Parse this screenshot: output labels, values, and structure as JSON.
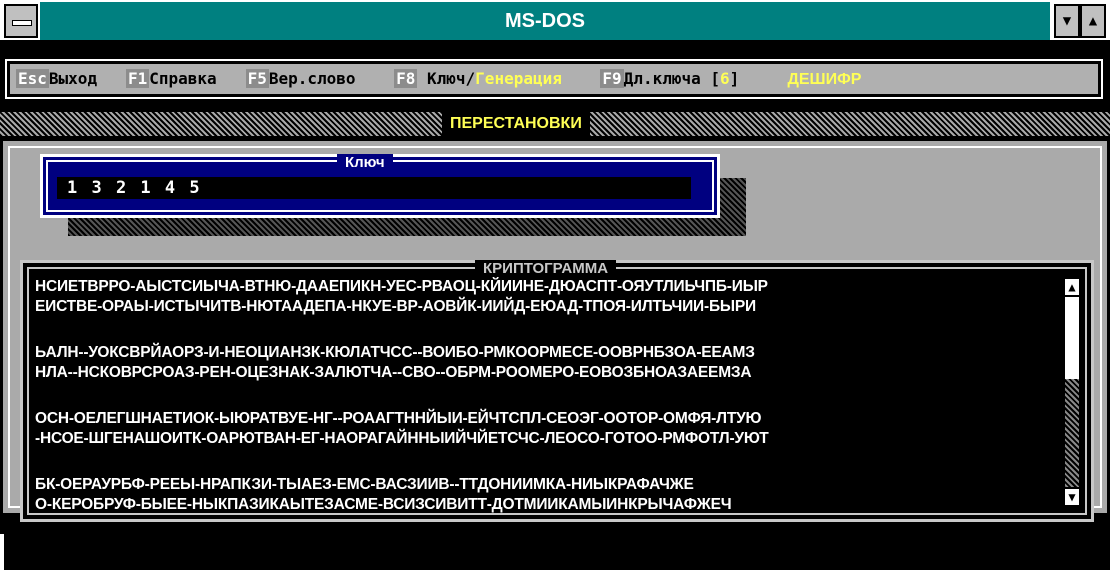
{
  "window": {
    "title": "MS-DOS",
    "min_button": "▼",
    "max_button": "▲"
  },
  "menu": {
    "esc_key": "Esc",
    "esc_label": "Выход",
    "f1_key": "F1",
    "f1_label": "Справка",
    "f5_key": "F5",
    "f5_label": "Вер.слово",
    "f8_key": "F8",
    "f8_label": "Ключ/",
    "f8_label_active": "Генерация",
    "f9_key": "F9",
    "f9_label": "Дл.ключа",
    "key_length_open": "[",
    "key_length_value": "6",
    "key_length_close": "]",
    "mode": "ДЕШИФР"
  },
  "banner": {
    "title": "ПЕРЕСТАНОВКИ"
  },
  "key_dialog": {
    "label": "Ключ",
    "value": "1 3 2 1 4 5"
  },
  "cryptogram": {
    "label": "КРИПТОГРАММА",
    "lines": [
      "НСИЕТВРРО-АЫСТСИЫЧА-ВТНЮ-ДААЕПИКН-УЕС-РВАОЦ-КЙИИНЕ-ДЮАСПТ-ОЯУТЛИЬЧПБ-ИЫР",
      "ЕИСТВЕ-ОРАЫ-ИСТЫЧИТВ-НЮТААДЕПА-НКУЕ-ВР-АОВЙК-ИИЙД-ЕЮАД-ТПОЯ-ИЛТЬЧИИ-БЫРИ",
      "ЬАЛН--УОКСВРЙАОРЗ-И-НЕОЦИАНЗК-КЮЛАТЧСС--ВОИБО-РМКООРМЕСЕ-ООВРНБЗОА-ЕЕАМЗ",
      "НЛА--НСКОВРСРОАЗ-РЕН-ОЦЕЗНАК-ЗАЛЮТЧА--СВО--ОБРМ-РООМЕРО-ЕОВОЗБНОАЗАЕЕМЗА",
      "ОСН-ОЕЛЕГШНАЕТИОК-ЫЮРАТВУЕ-НГ--РОААГТННЙЫИ-ЕЙЧТСПЛ-СЕОЭГ-ООТОР-ОМФЯ-ЛТУЮ",
      "-НСОЕ-ШГЕНАШОИТК-ОАРЮТВАН-ЕГ-НАОРАГАЙННЫИЙЧЙЕТСЧС-ЛЕОСО-ГОТОО-РМФОТЛ-УЮТ",
      "БК-ОЕРАУРБФ-РЕЕЫ-НРАПКЗИ-ТЫАЕЗ-ЕМС-ВАСЗИИВ--ТТДОНИИМКА-НИЫКРАФАЧЖЕ",
      "О-КЕРОБРУФ-БЫЕЕ-НЫКПАЗИКАЫТЕЗАСМЕ-ВСИЗСИВИТТ-ДОТМИИКАМЫИНКРЫЧАФЖЕЧ"
    ]
  },
  "scrollbar": {
    "up": "▲",
    "down": "▼"
  }
}
